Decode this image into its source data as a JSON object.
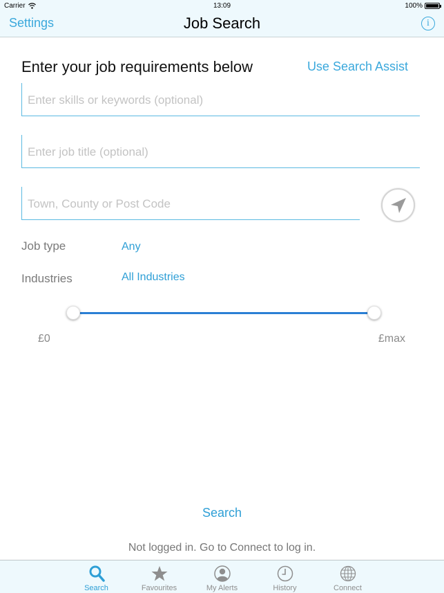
{
  "status_bar": {
    "carrier": "Carrier",
    "time": "13:09",
    "battery": "100%"
  },
  "nav": {
    "left_button": "Settings",
    "title": "Job Search",
    "right_icon": "info-icon"
  },
  "form": {
    "heading": "Enter your job requirements below",
    "assist_link": "Use Search Assist",
    "keywords": {
      "value": "",
      "placeholder": "Enter skills or keywords (optional)"
    },
    "job_title": {
      "value": "",
      "placeholder": "Enter job title (optional)"
    },
    "location": {
      "value": "",
      "placeholder": "Town, County or Post Code"
    },
    "locate_icon": "location-arrow-icon",
    "job_type": {
      "label": "Job type",
      "value": "Any"
    },
    "industries": {
      "label": "Industries",
      "value": "All Industries"
    },
    "salary": {
      "min_label": "£0",
      "max_label": "£max",
      "range_fraction": [
        0,
        1
      ]
    }
  },
  "search_button": "Search",
  "login_note": "Not logged in. Go to Connect to log in.",
  "colors": {
    "accent": "#2e9fd6",
    "slider": "#2a7fd4",
    "bar_background": "#eef9fd"
  },
  "tabs": [
    {
      "label": "Search",
      "icon": "search-icon",
      "active": true
    },
    {
      "label": "Favourites",
      "icon": "star-icon",
      "active": false
    },
    {
      "label": "My Alerts",
      "icon": "user-alert-icon",
      "active": false
    },
    {
      "label": "History",
      "icon": "clock-icon",
      "active": false
    },
    {
      "label": "Connect",
      "icon": "globe-icon",
      "active": false
    }
  ]
}
